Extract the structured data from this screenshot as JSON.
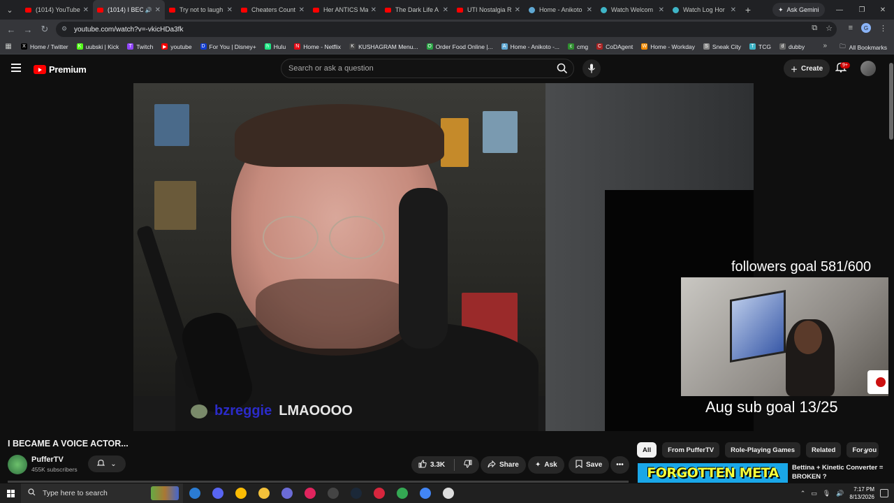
{
  "browser": {
    "tabs": [
      {
        "label": "(1014) YouTube",
        "icon": "youtube-icon",
        "active": false
      },
      {
        "label": "(1014) I BEC",
        "icon": "youtube-icon",
        "active": true,
        "audio": true
      },
      {
        "label": "Try not to laugh",
        "icon": "youtube-icon",
        "active": false
      },
      {
        "label": "Cheaters Count",
        "icon": "youtube-icon",
        "active": false
      },
      {
        "label": "Her ANTICS Ma",
        "icon": "youtube-icon",
        "active": false
      },
      {
        "label": "The Dark Life A",
        "icon": "youtube-icon",
        "active": false
      },
      {
        "label": "UTI Nostalgia R",
        "icon": "youtube-icon",
        "active": false
      },
      {
        "label": "Home - Anikoto",
        "icon": "globe-icon",
        "active": false
      },
      {
        "label": "Watch Welcom",
        "icon": "web-icon",
        "active": false
      },
      {
        "label": "Watch Log Hor",
        "icon": "web-icon",
        "active": false
      }
    ],
    "gemini_label": "Ask Gemini",
    "url": "youtube.com/watch?v=-vkicHDa3fk",
    "profile_initial": "G",
    "bookmarks": [
      {
        "label": "Home / Twitter",
        "color": "#000000",
        "glyph": "X"
      },
      {
        "label": "uubski | Kick",
        "color": "#53fc18",
        "glyph": "K"
      },
      {
        "label": "Twitch",
        "color": "#9146ff",
        "glyph": "T"
      },
      {
        "label": "youtube",
        "color": "#ff0000",
        "glyph": "▶"
      },
      {
        "label": "For You | Disney+",
        "color": "#113ccf",
        "glyph": "D"
      },
      {
        "label": "Hulu",
        "color": "#1ce783",
        "glyph": "h"
      },
      {
        "label": "Home - Netflix",
        "color": "#e50914",
        "glyph": "N"
      },
      {
        "label": "KUSHAGRAM Menu...",
        "color": "#444444",
        "glyph": "K"
      },
      {
        "label": "Order Food Online |...",
        "color": "#2aa745",
        "glyph": "O"
      },
      {
        "label": "Home - Anikoto -...",
        "color": "#5fa8d3",
        "glyph": "A"
      },
      {
        "label": "cmg",
        "color": "#2f8f2f",
        "glyph": "c"
      },
      {
        "label": "CoDAgent",
        "color": "#aa2222",
        "glyph": "C"
      },
      {
        "label": "Home - Workday",
        "color": "#f38b00",
        "glyph": "W"
      },
      {
        "label": "Sneak City",
        "color": "#888888",
        "glyph": "S"
      },
      {
        "label": "TCG",
        "color": "#3fb5c7",
        "glyph": "T"
      },
      {
        "label": "dubby",
        "color": "#666666",
        "glyph": "d"
      }
    ],
    "all_bookmarks": "All Bookmarks"
  },
  "youtube": {
    "logo_text": "Premium",
    "search_placeholder": "Search or ask a question",
    "create_label": "Create",
    "notification_count": "9+"
  },
  "video": {
    "chat_user": "bzreggie",
    "chat_message": "LMAOOOO",
    "followers_goal": "followers goal 581/600",
    "sub_goal": "Aug sub goal 13/25",
    "title": "I BECAME A VOICE ACTOR...",
    "channel_name": "PufferTV",
    "subscribers": "455K subscribers",
    "likes": "3.3K",
    "share_label": "Share",
    "ask_label": "Ask",
    "save_label": "Save"
  },
  "sidebar": {
    "chips": [
      "All",
      "From PufferTV",
      "Role-Playing Games",
      "Related",
      "For you"
    ],
    "recommendation": {
      "thumb_text": "FORGOTTEN META",
      "title": "Bettina + Kinetic Converter = BROKEN ?"
    }
  },
  "taskbar": {
    "search_placeholder": "Type here to search",
    "time": "7:17 PM",
    "date": "8/13/2026",
    "apps": [
      {
        "name": "edge-app-icon",
        "color": "#2b7cd3"
      },
      {
        "name": "discord-app-icon",
        "color": "#5865f2"
      },
      {
        "name": "chrome-app-icon",
        "color": "#fbbc04"
      },
      {
        "name": "file-explorer-icon",
        "color": "#f3c13a"
      },
      {
        "name": "game-app-icon",
        "color": "#6b6bd6"
      },
      {
        "name": "media-app-icon",
        "color": "#e0245e"
      },
      {
        "name": "obs-app-icon",
        "color": "#444444"
      },
      {
        "name": "steam-app-icon",
        "color": "#1b2838"
      },
      {
        "name": "adobe-app-icon",
        "color": "#d7263d"
      },
      {
        "name": "chrome-app-icon-2",
        "color": "#34a853"
      },
      {
        "name": "chrome-app-icon-3",
        "color": "#4285f4"
      },
      {
        "name": "clock-app-icon",
        "color": "#dddddd"
      }
    ]
  }
}
